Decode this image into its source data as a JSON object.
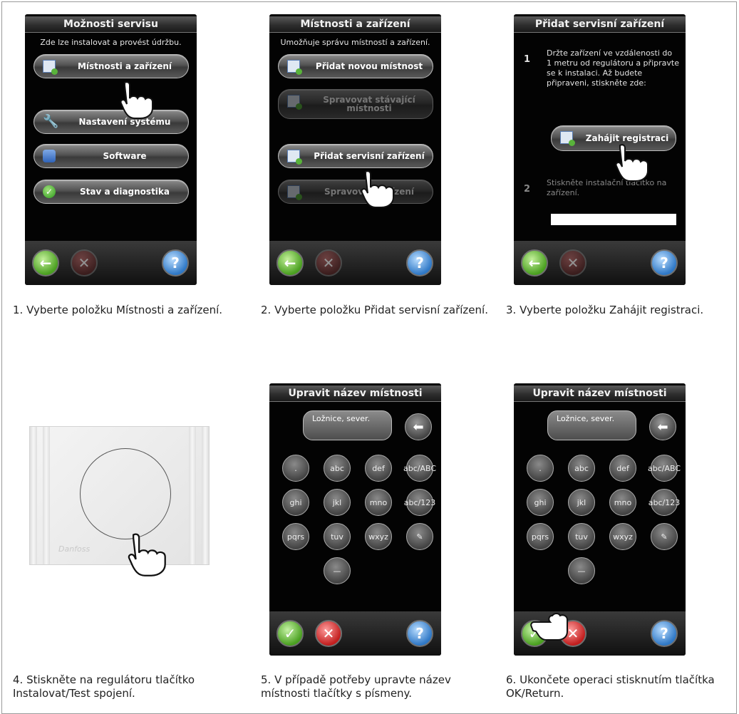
{
  "panels": [
    {
      "title": "Možnosti servisu",
      "subtitle": "Zde lze instalovat a provést údržbu.",
      "buttons": [
        "Místnosti a zařízení",
        "Nastavení systému",
        "Software",
        "Stav a diagnostika"
      ],
      "caption_num": "1.",
      "caption": "Vyberte položku Místnosti a zařízení."
    },
    {
      "title": "Místnosti a zařízení",
      "subtitle": "Umožňuje správu místností a zařízení.",
      "buttons": [
        "Přidat novou místnost",
        "Spravovat stávající místnosti",
        "Přidat servisní zařízení",
        "Spravovat zařízení"
      ],
      "caption_num": "2.",
      "caption": "Vyberte položku Přidat servisní zařízení."
    },
    {
      "title": "Přidat servisní zařízení",
      "step1_num": "1",
      "step1_text": "Držte zařízení ve vzdálenosti do 1 metru od regulátoru a připravte se k instalaci. Až budete připraveni, stiskněte zde:",
      "button": "Zahájit registraci",
      "step2_num": "2",
      "step2_text": "Stiskněte instalační tlačítko na zařízení.",
      "caption_num": "3.",
      "caption": "Vyberte položku Zahájit registraci."
    },
    {
      "caption_num": "4.",
      "caption": "Stiskněte na regulátoru tlačítko Instalovat/Test spojení.",
      "device_logo": "Danfoss"
    },
    {
      "title": "Upravit název místnosti",
      "field_value": "Ložnice, sever.",
      "keys": [
        ".",
        "abc",
        "def",
        "abc/ABC",
        "ghi",
        "jkl",
        "mno",
        "abc/123",
        "pqrs",
        "tuv",
        "wxyz",
        "✎",
        "—"
      ],
      "caption_num": "5.",
      "caption": "V případě potřeby upravte název místnosti tlačítky s písmeny."
    },
    {
      "title": "Upravit název místnosti",
      "field_value": "Ložnice, sever.",
      "keys": [
        ".",
        "abc",
        "def",
        "abc/ABC",
        "ghi",
        "jkl",
        "mno",
        "abc/123",
        "pqrs",
        "tuv",
        "wxyz",
        "✎",
        "—"
      ],
      "caption_num": "6.",
      "caption": "Ukončete operaci stisknutím tlačítka OK/Return."
    }
  ],
  "bar_icons": {
    "back": "←",
    "cancel": "✕",
    "ok": "✓",
    "help": "?"
  }
}
